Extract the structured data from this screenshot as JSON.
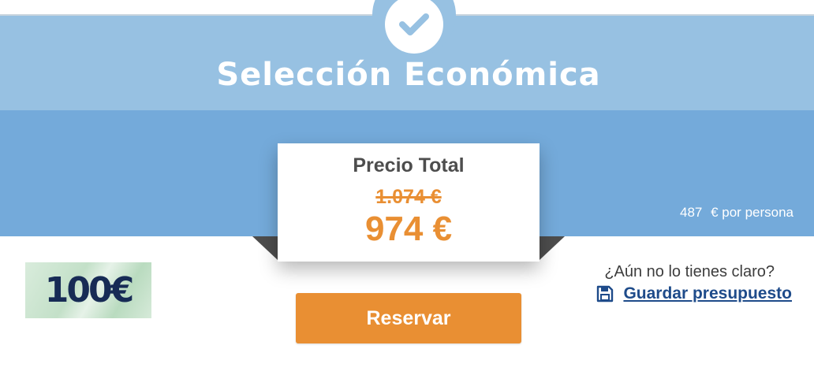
{
  "header": {
    "title": "Selección Económica",
    "icon": "check-icon"
  },
  "price_card": {
    "label": "Precio Total",
    "old_price": "1.074 €",
    "new_price": "974 €"
  },
  "per_person": {
    "amount": "487",
    "suffix": "€ por persona"
  },
  "badge": {
    "text": "100€"
  },
  "actions": {
    "reserve_label": "Reservar",
    "unsure_text": "¿Aún no lo tienes claro?",
    "save_label": "Guardar presupuesto",
    "save_icon": "floppy-disk-icon"
  },
  "colors": {
    "band_light": "#97c1e2",
    "band_dark": "#74aada",
    "accent_orange": "#e98f33",
    "link_blue": "#1e4b8a"
  }
}
